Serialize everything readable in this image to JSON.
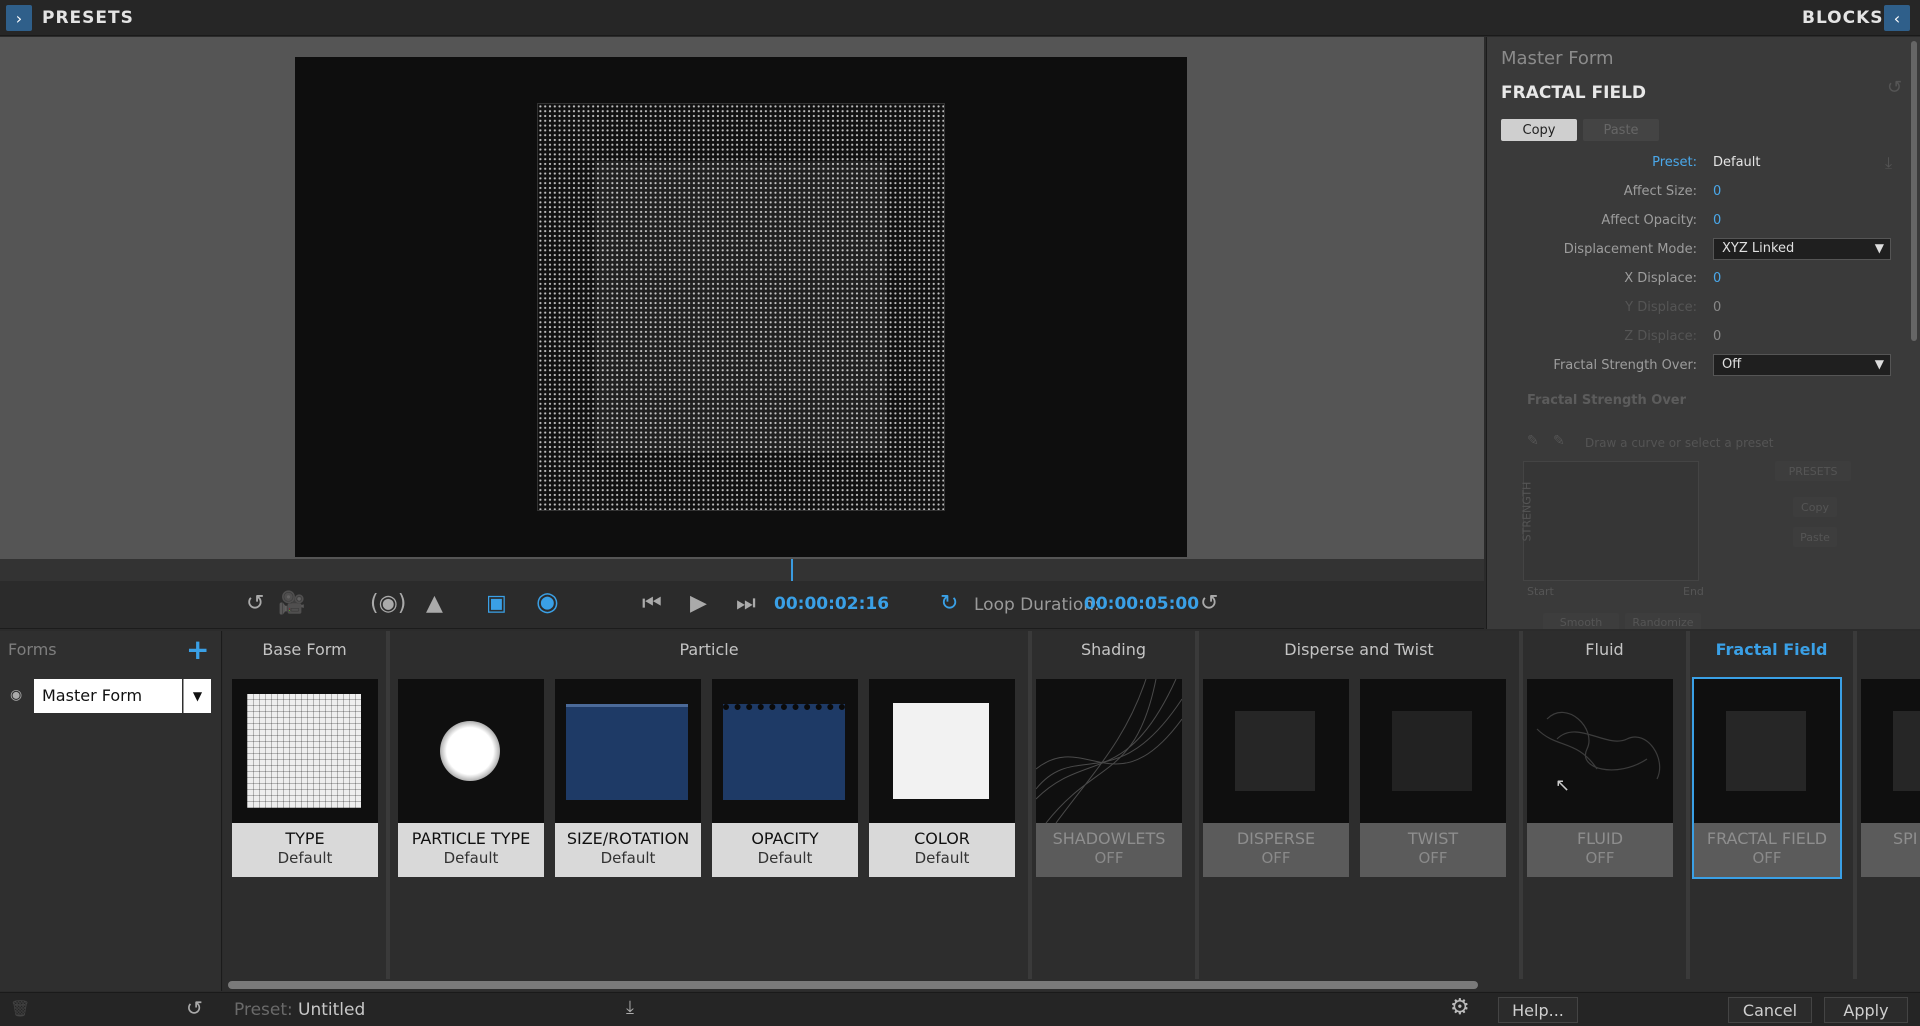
{
  "topbar": {
    "presets_title": "PRESETS",
    "blocks_title": "BLOCKS",
    "expand_icon": "chevron-right-icon",
    "collapse_icon": "chevron-left-icon"
  },
  "transport": {
    "timecode": "00:00:02:16",
    "loop_label": "Loop Duration:",
    "loop_value": "00:00:05:00"
  },
  "panel": {
    "subtitle": "Master Form",
    "title": "FRACTAL FIELD",
    "copy_label": "Copy",
    "paste_label": "Paste",
    "rows": [
      {
        "label": "Preset:",
        "value": "Default"
      },
      {
        "label": "Affect Size:",
        "value": "0"
      },
      {
        "label": "Affect Opacity:",
        "value": "0"
      },
      {
        "label": "Displacement Mode:",
        "value": "XYZ Linked"
      },
      {
        "label": "X Displace:",
        "value": "0"
      },
      {
        "label": "Y Displace:",
        "value": "0"
      },
      {
        "label": "Z Displace:",
        "value": "0"
      },
      {
        "label": "Fractal Strength Over:",
        "value": "Off"
      }
    ],
    "graph": {
      "section_title": "Fractal Strength Over",
      "hint": "Draw a curve or select a preset",
      "axis_label": "STRENGTH",
      "start": "Start",
      "end": "End",
      "presets_label": "PRESETS",
      "copy_label": "Copy",
      "paste_label": "Paste",
      "smooth_label": "Smooth",
      "randomize_label": "Randomize"
    }
  },
  "forms": {
    "header": "Forms",
    "master_form": "Master Form"
  },
  "groups": [
    {
      "label": "Base Form"
    },
    {
      "label": "Particle"
    },
    {
      "label": "Shading"
    },
    {
      "label": "Disperse and Twist"
    },
    {
      "label": "Fluid"
    },
    {
      "label": "Fractal Field"
    }
  ],
  "cards": [
    {
      "name": "TYPE",
      "status": "Default"
    },
    {
      "name": "PARTICLE TYPE",
      "status": "Default"
    },
    {
      "name": "SIZE/ROTATION",
      "status": "Default"
    },
    {
      "name": "OPACITY",
      "status": "Default"
    },
    {
      "name": "COLOR",
      "status": "Default"
    },
    {
      "name": "SHADOWLETS",
      "status": "OFF"
    },
    {
      "name": "DISPERSE",
      "status": "OFF"
    },
    {
      "name": "TWIST",
      "status": "OFF"
    },
    {
      "name": "FLUID",
      "status": "OFF"
    },
    {
      "name": "FRACTAL FIELD",
      "status": "OFF"
    },
    {
      "name": "SPI",
      "status": ""
    }
  ],
  "bottom": {
    "preset_label": "Preset:",
    "preset_value": "Untitled",
    "help_label": "Help...",
    "cancel_label": "Cancel",
    "apply_label": "Apply"
  },
  "colors": {
    "accent": "#3aa0e6",
    "background": "#2b2b2b"
  }
}
